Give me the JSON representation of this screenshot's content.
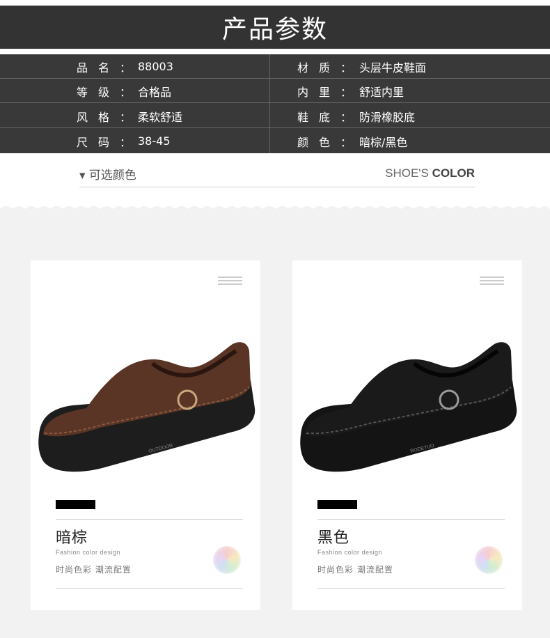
{
  "header": {
    "title": "产品参数"
  },
  "specs": [
    {
      "label": "品名",
      "value": "88003",
      "label2": "材质",
      "value2": "头层牛皮鞋面"
    },
    {
      "label": "等级",
      "value": "合格品",
      "label2": "内里",
      "value2": "舒适内里"
    },
    {
      "label": "风格",
      "value": "柔软舒适",
      "label2": "鞋底",
      "value2": "防滑橡胶底"
    },
    {
      "label": "尺码",
      "value": "38-45",
      "label2": "颜色",
      "value2": "暗棕/黑色"
    }
  ],
  "colon": "：",
  "color_section": {
    "left": "▾ 可选颜色",
    "right_thin": "SHOE'S ",
    "right_bold": "COLOR"
  },
  "cards": [
    {
      "name": "暗棕",
      "sub_en": "Fashion  color  design",
      "sub_cn": "时尚色彩  潮流配置",
      "shoe_color": "#5a3526",
      "sole_color": "#1d1d1d",
      "brand_text": "OUTDOOR"
    },
    {
      "name": "黑色",
      "sub_en": "Fashion  color  design",
      "sub_cn": "时尚色彩  潮流配置",
      "shoe_color": "#1a1a1a",
      "sole_color": "#141414",
      "brand_text": "RODETUO"
    }
  ]
}
